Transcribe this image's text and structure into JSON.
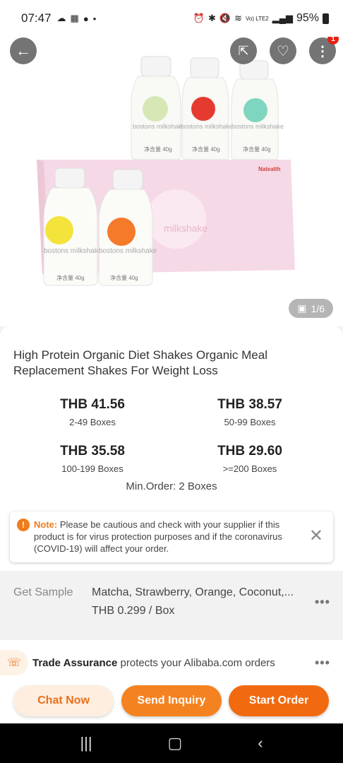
{
  "status_bar": {
    "time": "07:47",
    "battery": "95%",
    "signal_label": "Vo) LTE2"
  },
  "hero": {
    "image_counter": "1/6",
    "cart_badge": "1",
    "product_label": "milkshake",
    "bottle_label": "bostons milkshake",
    "bottle_weight": "净含量 40g",
    "brand": "Natealth"
  },
  "product": {
    "title": "High Protein Organic Diet Shakes Organic Meal Replacement Shakes For Weight Loss",
    "prices": [
      {
        "amount": "THB 41.56",
        "quantity": "2-49 Boxes"
      },
      {
        "amount": "THB 38.57",
        "quantity": "50-99 Boxes"
      },
      {
        "amount": "THB 35.58",
        "quantity": "100-199 Boxes"
      },
      {
        "amount": "THB 29.60",
        "quantity": ">=200 Boxes"
      }
    ],
    "min_order": "Min.Order: 2 Boxes"
  },
  "notice": {
    "label": "Note:",
    "text": "Please be cautious and check with your supplier if this product is for virus protection purposes and if the coronavirus (COVID-19) will affect your order."
  },
  "sample": {
    "label": "Get Sample",
    "flavors": "Matcha, Strawberry, Orange, Coconut,...",
    "price": "THB 0.299 / Box"
  },
  "trade": {
    "bold": "Trade Assurance",
    "text": " protects your Alibaba.com orders"
  },
  "actions": {
    "chat": "Chat Now",
    "inquiry": "Send Inquiry",
    "order": "Start Order"
  },
  "colors": {
    "accent": "#f26a10",
    "accent_light": "#fdeee0",
    "note": "#f07c1b"
  }
}
